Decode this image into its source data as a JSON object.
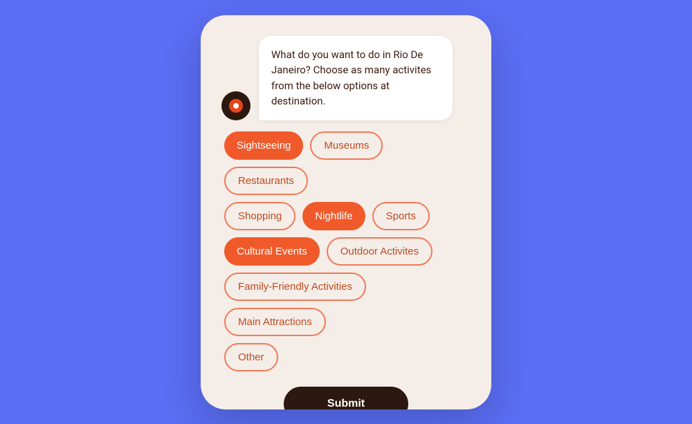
{
  "background_color": "#5b6ef5",
  "phone": {
    "background_color": "#f5ede8"
  },
  "message": {
    "text": "What do you want to do in Rio De Janeiro? Choose as many activites from the below options at destination."
  },
  "avatar": {
    "label": "AI avatar"
  },
  "options": [
    {
      "row": 0,
      "chips": [
        {
          "id": "sightseeing",
          "label": "Sightseeing",
          "selected": true
        },
        {
          "id": "museums",
          "label": "Museums",
          "selected": false
        },
        {
          "id": "restaurants",
          "label": "Restaurants",
          "selected": false
        }
      ]
    },
    {
      "row": 1,
      "chips": [
        {
          "id": "shopping",
          "label": "Shopping",
          "selected": false
        },
        {
          "id": "nightlife",
          "label": "Nightlife",
          "selected": true
        },
        {
          "id": "sports",
          "label": "Sports",
          "selected": false
        }
      ]
    },
    {
      "row": 2,
      "chips": [
        {
          "id": "cultural-events",
          "label": "Cultural Events",
          "selected": true
        },
        {
          "id": "outdoor-activites",
          "label": "Outdoor Activites",
          "selected": false
        }
      ]
    },
    {
      "row": 3,
      "chips": [
        {
          "id": "family-friendly",
          "label": "Family-Friendly Activities",
          "selected": false
        },
        {
          "id": "main-attractions",
          "label": "Main Attractions",
          "selected": false
        }
      ]
    },
    {
      "row": 4,
      "chips": [
        {
          "id": "other",
          "label": "Other",
          "selected": false
        }
      ]
    }
  ],
  "submit": {
    "label": "Submit"
  }
}
